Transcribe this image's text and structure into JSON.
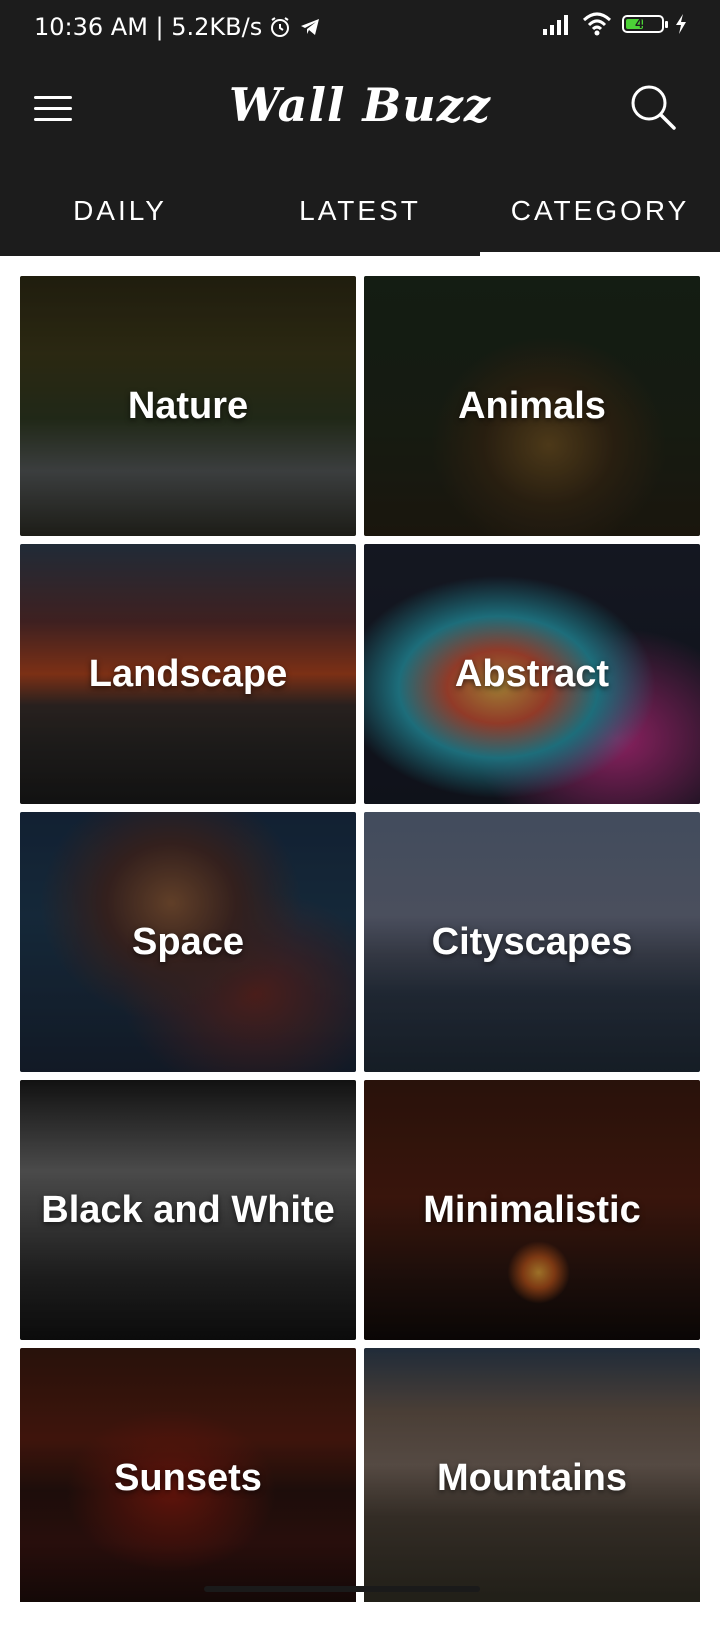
{
  "status_bar": {
    "time_speed": "10:36 AM | 5.2KB/s",
    "battery_level": "49"
  },
  "app_bar": {
    "title": "Wall Buzz"
  },
  "tabs": [
    {
      "label": "DAILY",
      "active": false
    },
    {
      "label": "LATEST",
      "active": false
    },
    {
      "label": "CATEGORY",
      "active": true
    }
  ],
  "categories": [
    {
      "label": "Nature"
    },
    {
      "label": "Animals"
    },
    {
      "label": "Landscape"
    },
    {
      "label": "Abstract"
    },
    {
      "label": "Space"
    },
    {
      "label": "Cityscapes"
    },
    {
      "label": "Black and White"
    },
    {
      "label": "Minimalistic"
    },
    {
      "label": "Sunsets"
    },
    {
      "label": "Mountains"
    }
  ],
  "colors": {
    "app_bar_bg": "#1c1c1c",
    "accent": "#ffffff",
    "battery_green": "#4cd137"
  }
}
